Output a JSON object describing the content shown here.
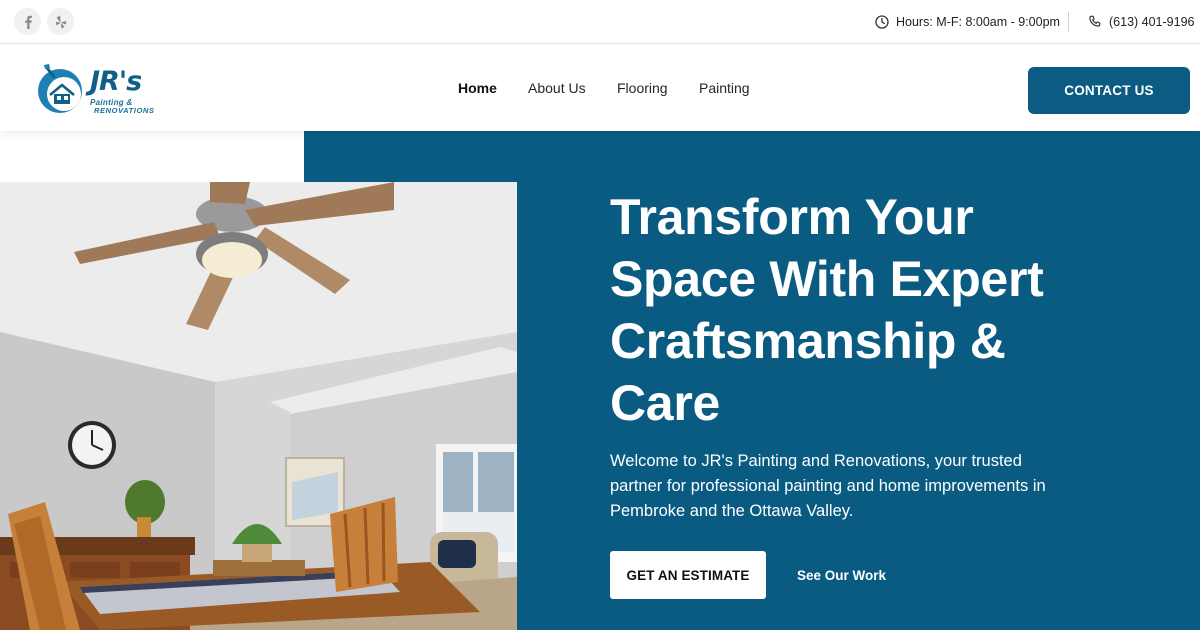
{
  "topbar": {
    "social": [
      {
        "icon": "facebook-icon"
      },
      {
        "icon": "yelp-icon"
      }
    ],
    "hours": "Hours: M-F: 8:00am - 9:00pm",
    "phone": "(613) 401-9196"
  },
  "header": {
    "logo": {
      "brand": "JR's",
      "sub1": "Painting &",
      "sub2": "RENOVATIONS"
    },
    "nav": [
      "Home",
      "About Us",
      "Flooring",
      "Painting"
    ],
    "active_nav": "Home",
    "cta": "CONTACT US"
  },
  "hero": {
    "title": "Transform Your Space With Expert Craftsmanship & Care",
    "text": "Welcome to JR's Painting and Renovations, your trusted partner for professional painting and home improvements in Pembroke and the Ottawa Valley.",
    "primary_button": "GET AN ESTIMATE",
    "secondary_button": "See Our Work"
  },
  "colors": {
    "brand_blue": "#0a5b82",
    "button_blue": "#0c5b82",
    "white": "#ffffff"
  }
}
